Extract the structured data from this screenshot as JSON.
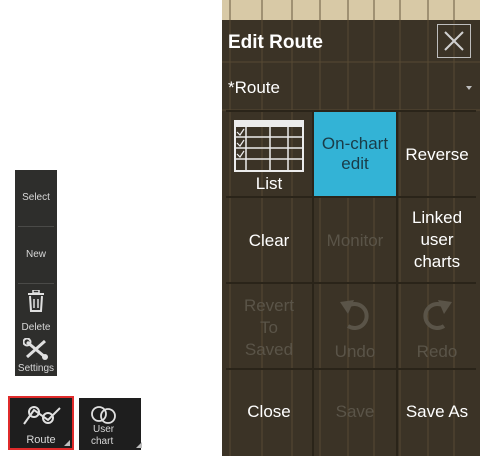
{
  "toolbar": {
    "select_label": "Select",
    "new_label": "New",
    "delete_label": "Delete",
    "settings_label": "Settings",
    "route_label": "Route",
    "user_chart_label_1": "User",
    "user_chart_label_2": "chart"
  },
  "panel": {
    "title": "Edit Route",
    "route_name": "*Route",
    "buttons": {
      "list": "List",
      "on_chart_1": "On-chart",
      "on_chart_2": "edit",
      "reverse": "Reverse",
      "clear": "Clear",
      "monitor": "Monitor",
      "linked_1": "Linked",
      "linked_2": "user",
      "linked_3": "charts",
      "revert_1": "Revert",
      "revert_2": "To",
      "revert_3": "Saved",
      "undo": "Undo",
      "redo": "Redo",
      "close": "Close",
      "save": "Save",
      "save_as": "Save As"
    }
  },
  "colors": {
    "highlight": "#e02b2b",
    "active": "#33b3d6",
    "panel_bg": "#3b3326"
  }
}
